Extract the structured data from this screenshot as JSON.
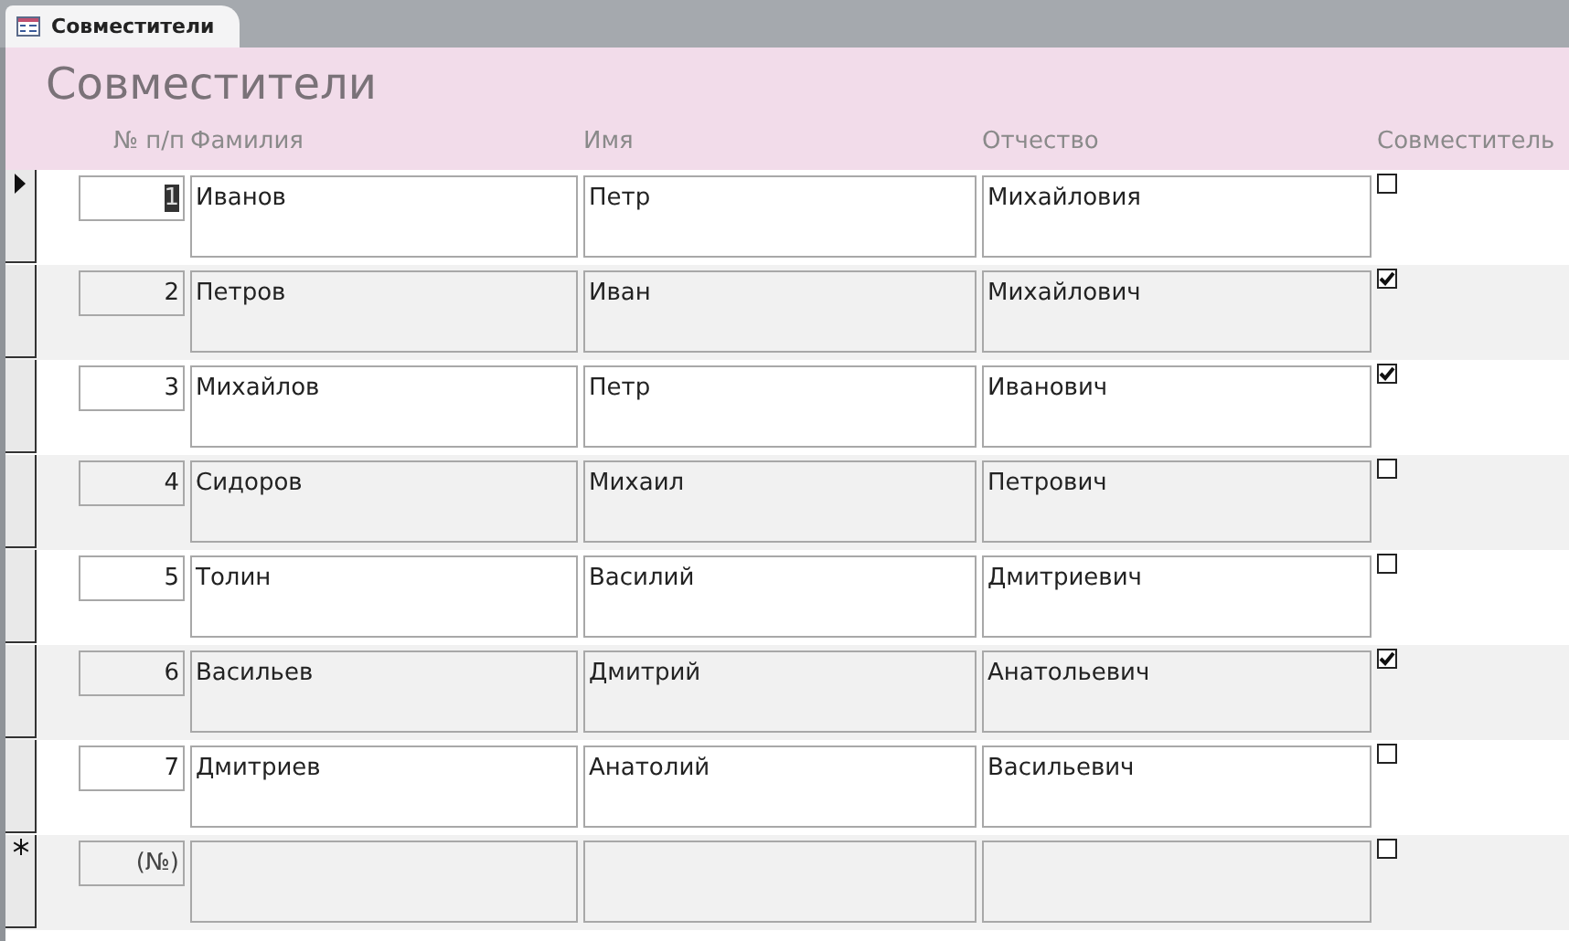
{
  "tab": {
    "title": "Совместители",
    "selected": true
  },
  "form": {
    "title": "Совместители",
    "columns": [
      "№ п/п",
      "Фамилия",
      "Имя",
      "Отчество",
      "Совместитель"
    ],
    "rows": [
      {
        "number": "1",
        "last_name": "Иванов",
        "first_name": "Петр",
        "patronymic": "Михайловия",
        "checked": false,
        "selected": true
      },
      {
        "number": "2",
        "last_name": "Петров",
        "first_name": "Иван",
        "patronymic": "Михайлович",
        "checked": true,
        "selected": false
      },
      {
        "number": "3",
        "last_name": "Михайлов",
        "first_name": "Петр",
        "patronymic": "Иванович",
        "checked": true,
        "selected": false
      },
      {
        "number": "4",
        "last_name": "Сидоров",
        "first_name": "Михаил",
        "patronymic": "Петрович",
        "checked": false,
        "selected": false
      },
      {
        "number": "5",
        "last_name": "Толин",
        "first_name": "Василий",
        "patronymic": "Дмитриевич",
        "checked": false,
        "selected": false
      },
      {
        "number": "6",
        "last_name": "Васильев",
        "first_name": "Дмитрий",
        "patronymic": "Анатольевич",
        "checked": true,
        "selected": false
      },
      {
        "number": "7",
        "last_name": "Дмитриев",
        "first_name": "Анатолий",
        "patronymic": "Васильевич",
        "checked": false,
        "selected": false
      }
    ],
    "new_row": {
      "number_placeholder": "(№)",
      "checked": false
    }
  }
}
